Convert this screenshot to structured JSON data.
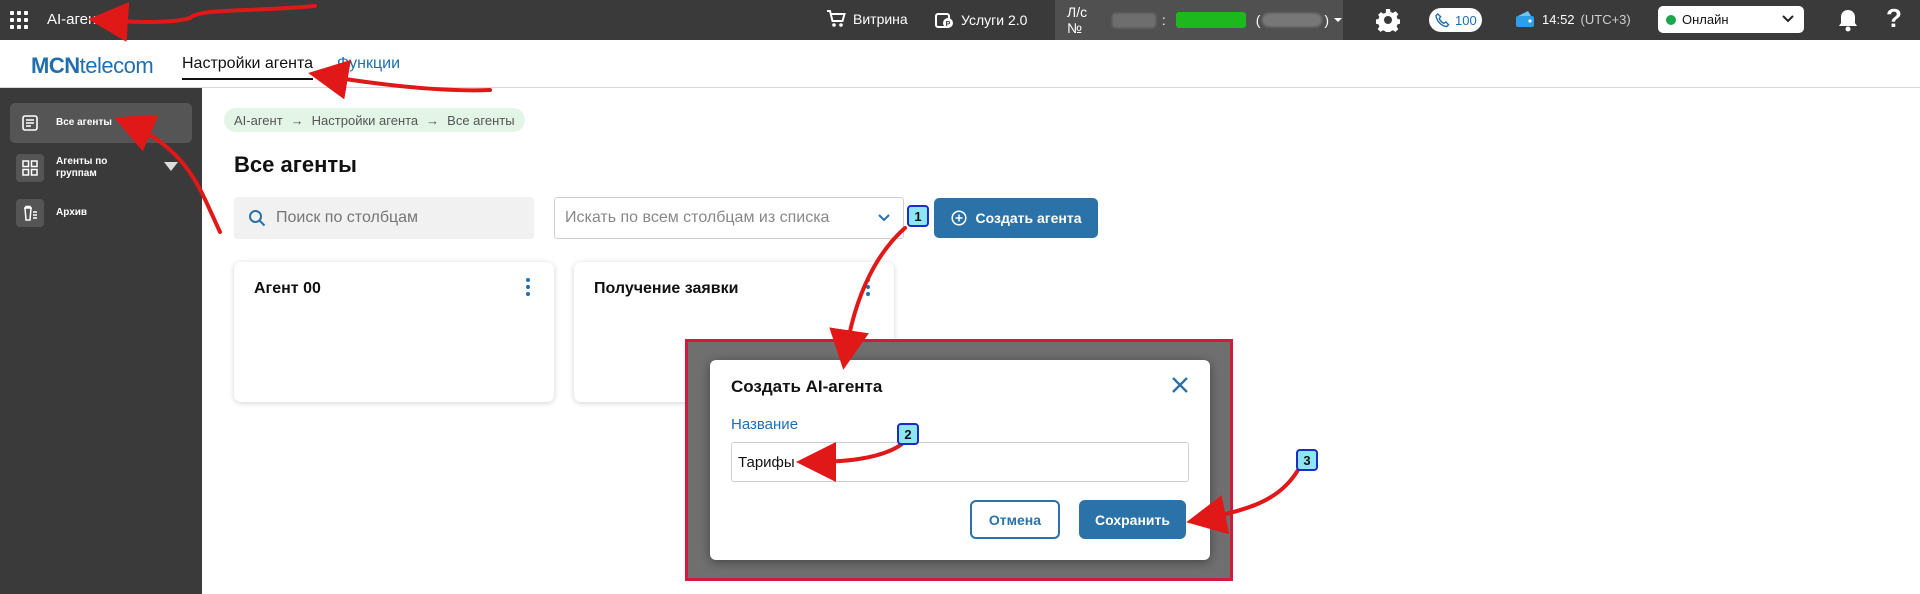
{
  "topbar": {
    "app_name": "AI-агент",
    "shop_label": "Витрина",
    "services_label": "Услуги 2.0",
    "account_prefix": "Л/с №",
    "account_sep": ":",
    "account_open": "(",
    "account_close": ")",
    "calls_count": "100",
    "time": "14:52",
    "timezone": "(UTC+3)",
    "status": "Онлайн",
    "help_symbol": "?"
  },
  "subheader": {
    "logo_bold": "MCN",
    "logo_rest": "telecom",
    "tabs": [
      {
        "label": "Настройки агента"
      },
      {
        "label": "Функции"
      }
    ]
  },
  "sidebar": {
    "items": [
      {
        "label": "Все агенты"
      },
      {
        "label": "Агенты по группам"
      },
      {
        "label": "Архив"
      }
    ]
  },
  "breadcrumb": {
    "items": [
      "AI-агент",
      "Настройки агента",
      "Все агенты"
    ],
    "separator": "→"
  },
  "main": {
    "title": "Все агенты",
    "search_placeholder": "Поиск по столбцам",
    "column_select_placeholder": "Искать по всем столбцам из списка",
    "create_button": "Создать агента",
    "cards": [
      {
        "title": "Агент 00"
      },
      {
        "title": "Получение заявки"
      }
    ]
  },
  "modal": {
    "title": "Создать AI-агента",
    "name_label": "Название",
    "name_value": "Тарифы",
    "cancel": "Отмена",
    "save": "Сохранить"
  },
  "markers": [
    "1",
    "2",
    "3"
  ],
  "colors": {
    "accent": "#2a72a8",
    "topbar": "#3a3a3a",
    "annotation_arrow": "#e01818",
    "annotation_frame": "#d41a3c",
    "online": "#18a84b"
  }
}
